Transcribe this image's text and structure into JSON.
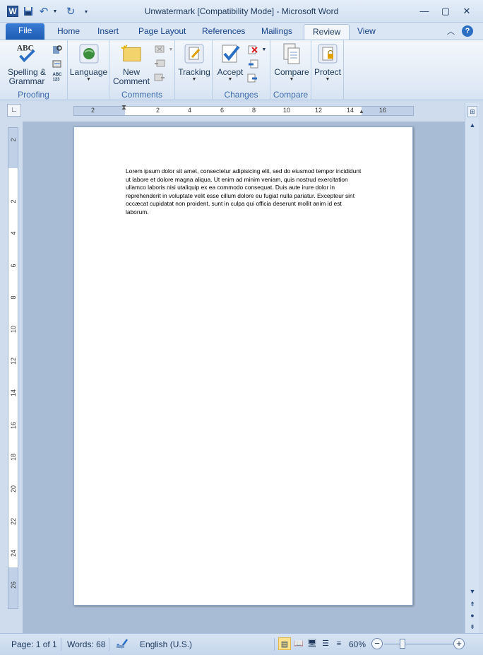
{
  "window": {
    "title": "Unwatermark [Compatibility Mode]  -  Microsoft Word",
    "app_icon_letter": "W",
    "buttons": {
      "minimize": "—",
      "maximize": "▢",
      "close": "✕"
    }
  },
  "tabs": [
    {
      "label": "File"
    },
    {
      "label": "Home"
    },
    {
      "label": "Insert"
    },
    {
      "label": "Page Layout"
    },
    {
      "label": "References"
    },
    {
      "label": "Mailings"
    },
    {
      "label": "Review"
    },
    {
      "label": "View"
    }
  ],
  "ribbon": {
    "proofing": {
      "spelling_line1": "Spelling &",
      "spelling_line2": "Grammar",
      "label": "Proofing"
    },
    "language": {
      "label": "Language"
    },
    "comments": {
      "new_line1": "New",
      "new_line2": "Comment",
      "label": "Comments"
    },
    "tracking": {
      "label": "Tracking"
    },
    "changes": {
      "accept": "Accept",
      "label": "Changes"
    },
    "compare": {
      "button": "Compare",
      "label": "Compare"
    },
    "protect": {
      "label": "Protect"
    }
  },
  "ruler": {
    "h_ticks": [
      "2",
      "2",
      "4",
      "6",
      "8",
      "10",
      "12",
      "14",
      "16"
    ],
    "v_ticks": [
      "2",
      "2",
      "4",
      "6",
      "8",
      "10",
      "12",
      "14",
      "16",
      "18",
      "20",
      "22",
      "24",
      "26"
    ]
  },
  "document": {
    "text": "Lorem ipsum dolor sit amet, consectetur adipisicing elit, sed do eiusmod tempor incididunt ut labore et dolore magna aliqua. Ut enim ad minim veniam, quis nostrud exercitation ullamco laboris nisi utaliquip ex ea commodo consequat. Duis aute irure dolor in reprehenderit in voluptate velit esse cillum dolore eu fugiat nulla pariatur. Excepteur sint occæcat cupidatat non proident, sunt in culpa qui officia deserunt mollit anim id est laborum."
  },
  "status": {
    "page": "Page: 1 of 1",
    "words": "Words: 68",
    "language": "English (U.S.)",
    "zoom": "60%",
    "zoom_value": 60
  },
  "colors": {
    "file_tab": "#2b6fc4",
    "ribbon_bg": "#dfe9f5",
    "doc_bg": "#a9bcd6"
  }
}
